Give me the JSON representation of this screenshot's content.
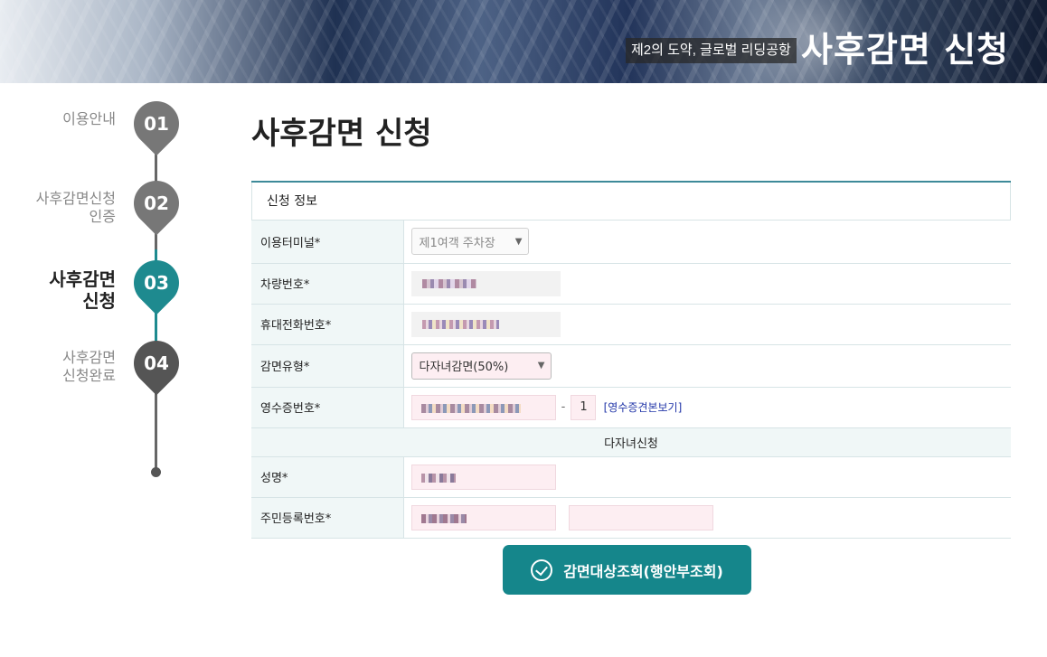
{
  "header": {
    "slogan": "제2의 도약, 글로벌 리딩공항",
    "title": "사후감면 신청"
  },
  "steps": [
    {
      "number": "01",
      "label_line1": "이용안내",
      "label_line2": "",
      "state": "done"
    },
    {
      "number": "02",
      "label_line1": "사후감면신청",
      "label_line2": "인증",
      "state": "done"
    },
    {
      "number": "03",
      "label_line1": "사후감면",
      "label_line2": "신청",
      "state": "active"
    },
    {
      "number": "04",
      "label_line1": "사후감면",
      "label_line2": "신청완료",
      "state": "pending"
    }
  ],
  "main": {
    "title": "사후감면 신청",
    "section_title": "신청 정보",
    "fields": {
      "terminal": {
        "label": "이용터미널*",
        "value": "제1여객 주차장"
      },
      "car_number": {
        "label": "차량번호*"
      },
      "phone": {
        "label": "휴대전화번호*"
      },
      "discount_type": {
        "label": "감면유형*",
        "value": "다자녀감면(50%)"
      },
      "receipt": {
        "label": "영수증번호*",
        "suffix_value": "1",
        "link": "[영수증견본보기]"
      }
    },
    "subsection_title": "다자녀신청",
    "sub_fields": {
      "name": {
        "label": "성명*"
      },
      "resident_number": {
        "label": "주민등록번호*"
      }
    },
    "submit_label": "감면대상조회(행안부조회)"
  },
  "colors": {
    "accent": "#15868b",
    "step_active": "#1e8a8f",
    "step_inactive": "#777777",
    "table_header_bg": "#f0f7f7",
    "input_pink": "#fdeef2"
  }
}
